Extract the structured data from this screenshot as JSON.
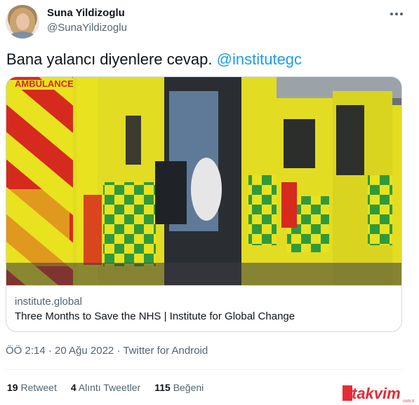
{
  "user": {
    "name": "Suna Yildizoglu",
    "handle": "@SunaYildizoglu"
  },
  "tweet": {
    "text": "Bana yalancı diyenlere cevap.",
    "mention": "@institutegc"
  },
  "card": {
    "domain": "institute.global",
    "title": "Three Months to Save the NHS | Institute for Global Change",
    "image_text": "AMBULANCE"
  },
  "meta": {
    "timestamp": "ÖÖ 2:14 · 20 Ağu 2022 · Twitter for Android"
  },
  "stats": {
    "retweets_count": "19",
    "retweets_label": "Retweet",
    "quotes_count": "4",
    "quotes_label": "Alıntı Tweetler",
    "likes_count": "115",
    "likes_label": "Beğeni"
  },
  "watermark": {
    "text": "takvim",
    "suffix": "com.tr"
  },
  "colors": {
    "accent": "#1d9bf0",
    "ambulance_yellow": "#e8e21f",
    "ambulance_green": "#2f9a3c",
    "ambulance_red": "#d62a1e",
    "watermark_red": "#e30613"
  }
}
